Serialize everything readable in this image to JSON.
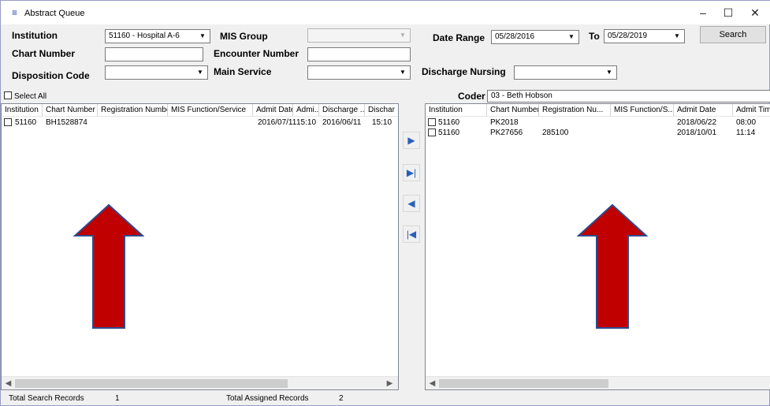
{
  "window": {
    "title": "Abstract Queue",
    "minimize": "–",
    "maximize": "☐",
    "close": "✕"
  },
  "form": {
    "institution_label": "Institution",
    "institution_value": "51160 - Hospital A-6",
    "mis_group_label": "MIS Group",
    "mis_group_value": "",
    "date_range_label": "Date Range",
    "date_from": "05/28/2016",
    "to_label": "To",
    "date_to": "05/28/2019",
    "search_label": "Search",
    "chart_number_label": "Chart Number",
    "chart_number_value": "",
    "encounter_number_label": "Encounter Number",
    "encounter_number_value": "",
    "disposition_code_label": "Disposition Code",
    "disposition_code_value": "",
    "main_service_label": "Main Service",
    "main_service_value": "",
    "discharge_nursing_label": "Discharge Nursing",
    "discharge_nursing_value": "",
    "coder_label": "Coder",
    "coder_value": "03 - Beth Hobson",
    "select_all_label": "Select All"
  },
  "left_list": {
    "columns": [
      "Institution",
      "Chart Number",
      "Registration Number",
      "MIS Function/Service",
      "Admit Date",
      "Admi...",
      "Discharge ...",
      "Dischar"
    ],
    "rows": [
      [
        "51160",
        "BH1528874",
        "",
        "",
        "2016/07/11",
        "15:10",
        "2016/06/11",
        "15:10"
      ]
    ]
  },
  "right_list": {
    "columns": [
      "Institution",
      "Chart Number",
      "Registration Nu...",
      "MIS Function/S...",
      "Admit Date",
      "Admit Time"
    ],
    "rows": [
      [
        "51160",
        "PK2018",
        "",
        "",
        "2018/06/22",
        "08:00"
      ],
      [
        "51160",
        "PK27656",
        "285100",
        "",
        "2018/10/01",
        "11:14"
      ]
    ]
  },
  "move_buttons": {
    "move_right": "▶",
    "move_all_right": "▶|",
    "move_left": "◀",
    "move_all_left": "|◀"
  },
  "status_bar": {
    "total_search_label": "Total Search Records",
    "total_search_value": "1",
    "total_assigned_label": "Total Assigned Records",
    "total_assigned_value": "2"
  },
  "colors": {
    "arrow_fill": "#c00000",
    "arrow_stroke": "#2f4b8f",
    "accent": "#1a4ca0"
  },
  "icons": {
    "menu": "menu-icon",
    "combo": "chevron-down-icon",
    "arrow": "annotation-arrow-up-icon"
  }
}
